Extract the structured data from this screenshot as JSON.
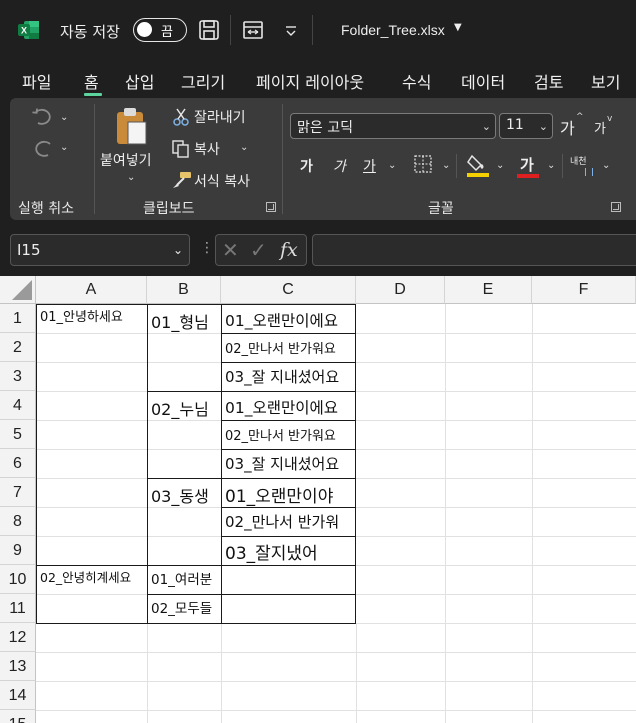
{
  "titlebar": {
    "autosave_label": "자동 저장",
    "autosave_state": "끔",
    "file_name": "Folder_Tree.xlsx"
  },
  "tabs": [
    "파일",
    "홈",
    "삽입",
    "그리기",
    "페이지 레이아웃",
    "수식",
    "데이터",
    "검토",
    "보기"
  ],
  "active_tab": "홈",
  "ribbon": {
    "undo_group_label": "실행 취소",
    "clipboard": {
      "paste_label": "붙여넣기",
      "cut_label": "잘라내기",
      "copy_label": "복사",
      "format_painter_label": "서식 복사",
      "group_label": "클립보드"
    },
    "font": {
      "font_name": "맑은 고딕",
      "font_size": "11",
      "bold": "가",
      "italic": "가",
      "underline": "가",
      "font_color_glyph": "가",
      "highlight_color": "#f5d000",
      "font_color": "#e02020",
      "grow_label": "가",
      "shrink_label": "가",
      "phonetic_label": "내천",
      "group_label": "글꼴"
    }
  },
  "formula_bar": {
    "name_box": "I15",
    "fx": "fx",
    "formula": ""
  },
  "sheet": {
    "columns": [
      "A",
      "B",
      "C",
      "D",
      "E",
      "F"
    ],
    "rows": [
      "1",
      "2",
      "3",
      "4",
      "5",
      "6",
      "7",
      "8",
      "9",
      "10",
      "11",
      "12",
      "13",
      "14",
      "15"
    ],
    "cells": {
      "A1": "01_안녕하세요",
      "A10": "02_안녕히계세요",
      "B1": "01_형님",
      "B4": "02_누님",
      "B7": "03_동생",
      "B10": "01_여러분",
      "B11": "02_모두들",
      "C1": "01_오랜만이에요",
      "C2": "02_만나서 반가워요",
      "C3": "03_잘 지내셨어요",
      "C4": "01_오랜만이에요",
      "C5": "02_만나서 반가워요",
      "C6": "03_잘 지내셨어요",
      "C7": "01_오랜만이야",
      "C8": "02_만나서 반가워",
      "C9": "03_잘지냈어"
    }
  }
}
